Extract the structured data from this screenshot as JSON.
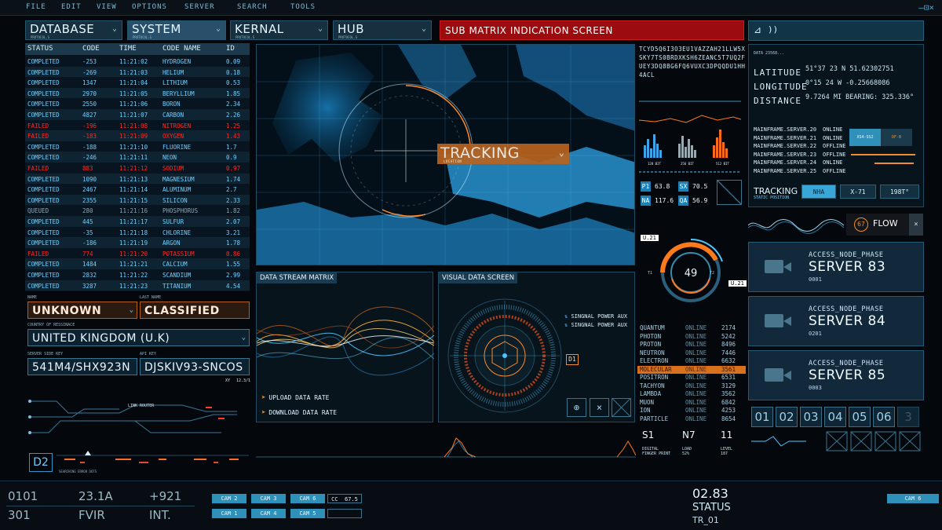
{
  "menu": [
    "FILE",
    "EDIT",
    "VIEW",
    "OPTIONS",
    "SERVER",
    "SEARCH",
    "TOOLS"
  ],
  "window_controls": "—⊡×",
  "dropdowns": [
    {
      "label": "DATABASE",
      "sub": "PROTOCOL.S"
    },
    {
      "label": "SYSTEM",
      "sub": "PROTOCOL.S"
    },
    {
      "label": "KERNAL",
      "sub": "PROTOCOL.S"
    },
    {
      "label": "HUB",
      "sub": "PROTOCOL.S"
    }
  ],
  "sub_matrix_title": "SUB MATRIX INDICATION SCREEN",
  "table": {
    "headers": [
      "STATUS",
      "CODE",
      "TIME",
      "CODE NAME",
      "ID"
    ],
    "rows": [
      [
        "COMPLETED",
        "-253",
        "11:21:02",
        "HYDROGEN",
        "0.09"
      ],
      [
        "COMPLETED",
        "-269",
        "11:21:03",
        "HELIUM",
        "0.18"
      ],
      [
        "COMPLETED",
        "1347",
        "11:21:04",
        "LITHIUM",
        "0.53"
      ],
      [
        "COMPLETED",
        "2970",
        "11:21:05",
        "BERYLLIUM",
        "1.85"
      ],
      [
        "COMPLETED",
        "2550",
        "11:21:06",
        "BORON",
        "2.34"
      ],
      [
        "COMPLETED",
        "4827",
        "11:21:07",
        "CARBON",
        "2.26"
      ],
      [
        "FAILED",
        "-196",
        "11:21:08",
        "NITROGEN",
        "1.25"
      ],
      [
        "FAILED",
        "-183",
        "11:21:09",
        "OXYGEN",
        "1.43"
      ],
      [
        "COMPLETED",
        "-188",
        "11:21:10",
        "FLUORINE",
        "1.7"
      ],
      [
        "COMPLETED",
        "-246",
        "11:21:11",
        "NEON",
        "0.9"
      ],
      [
        "FAILED",
        "883",
        "11:21:12",
        "SODIUM",
        "0.97"
      ],
      [
        "COMPLETED",
        "1090",
        "11:21:13",
        "MAGNESIUM",
        "1.74"
      ],
      [
        "COMPLETED",
        "2467",
        "11:21:14",
        "ALUMINUM",
        "2.7"
      ],
      [
        "COMPLETED",
        "2355",
        "11:21:15",
        "SILICON",
        "2.33"
      ],
      [
        "QUEUED",
        "280",
        "11:21:16",
        "PHOSPHORUS",
        "1.82"
      ],
      [
        "COMPLETED",
        "445",
        "11:21:17",
        "SULFUR",
        "2.07"
      ],
      [
        "COMPLETED",
        "-35",
        "11:21:18",
        "CHLORINE",
        "3.21"
      ],
      [
        "COMPLETED",
        "-186",
        "11:21:19",
        "ARGON",
        "1.78"
      ],
      [
        "FAILED",
        "774",
        "11:21:20",
        "POTASSIUM",
        "0.86"
      ],
      [
        "COMPLETED",
        "1484",
        "11:21:21",
        "CALCIUM",
        "1.55"
      ],
      [
        "COMPLETED",
        "2832",
        "11:21:22",
        "SCANDIUM",
        "2.99"
      ],
      [
        "COMPLETED",
        "3287",
        "11:21:23",
        "TITANIUM",
        "4.54"
      ]
    ]
  },
  "form": {
    "name_label": "NAME",
    "name": "UNKNOWN",
    "last_name_label": "LAST NAME",
    "last_name": "CLASSIFIED",
    "country_label": "COUNTRY OF RESSINACE",
    "country": "UNITED KINGDOM (U.K)",
    "server_key_label": "SERVER SIDE KEY",
    "server_key": "541M4/SHX923N",
    "api_key_label": "API KEY",
    "api_key": "DJSKIV93-SNCOS",
    "xy": "XY",
    "xy_val": "12.3/1"
  },
  "router": {
    "title": "LINK ROUTER",
    "badge": "D2",
    "footer": "SEARCHING ERROR DOTS"
  },
  "map": {
    "tracking": "TRACKING",
    "tracking_sub": "LOCATION"
  },
  "data_stream": {
    "title": "DATA STREAM MATRIX",
    "upload": "UPLOAD DATA RATE",
    "download": "DOWNLOAD DATA RATE"
  },
  "visual": {
    "title": "VISUAL DATA SCREEN",
    "power1": "SINGNAL POWER AUX",
    "power2": "SINGNAL POWER AUX",
    "tag": "D1"
  },
  "codes": "TCYD5Q6I3O3EU1VAZZAH21LLW5XSKY7TS0BRDXKSH6ZEANC5T7UQ2FUEY3DQ8BG6FQ6VUXC3DPQQDU1HH4ACL",
  "bits": [
    "128 BIT",
    "256 BIT",
    "512 BIT"
  ],
  "stats": [
    {
      "k": "P1",
      "v": "63.8"
    },
    {
      "k": "SX",
      "v": "70.5"
    },
    {
      "k": "NA",
      "v": "117.6"
    },
    {
      "k": "QA",
      "v": "56.9"
    }
  ],
  "gauge": {
    "value": "49",
    "tag1": "U.21",
    "tag2": "U.21",
    "t1": "T1",
    "t2": "T2"
  },
  "elements": [
    {
      "name": "QUANTUM",
      "status": "ONLINE",
      "code": "2174"
    },
    {
      "name": "PHOTON",
      "status": "ONLINE",
      "code": "5242"
    },
    {
      "name": "PROTON",
      "status": "ONLINE",
      "code": "8496"
    },
    {
      "name": "NEUTRON",
      "status": "ONLINE",
      "code": "7446"
    },
    {
      "name": "ELECTRON",
      "status": "ONLINE",
      "code": "6632"
    },
    {
      "name": "MOLECULAR",
      "status": "ONLINE",
      "code": "3561"
    },
    {
      "name": "POSITRON",
      "status": "ONLINE",
      "code": "6531"
    },
    {
      "name": "TACHYON",
      "status": "ONLINE",
      "code": "3129"
    },
    {
      "name": "LAMBDA",
      "status": "ONLINE",
      "code": "3562"
    },
    {
      "name": "MUON",
      "status": "ONLINE",
      "code": "6842"
    },
    {
      "name": "ION",
      "status": "ONLINE",
      "code": "4253"
    },
    {
      "name": "PARTICLE",
      "status": "ONLINE",
      "code": "8654"
    }
  ],
  "readouts": [
    {
      "v": "S1",
      "l1": "DIGITAL",
      "l2": "FINGER PRINT"
    },
    {
      "v": "N7",
      "l1": "LOAD",
      "l2": "52%"
    },
    {
      "v": "11",
      "l1": "LEVEL",
      "l2": "187"
    }
  ],
  "coords": {
    "data": "DATA 23568...",
    "lat_label": "LATITUDE",
    "lat": "51°37 23 N  51.62302751",
    "lon_label": "LONGITUDE",
    "lon": "0°15 24 W  -0.25668086",
    "dist_label": "DISTANCE",
    "dist": "9.7264 MI  BEARING: 325.336°"
  },
  "mainframes": [
    {
      "name": "MAINFRAME.SERVER.20",
      "status": "ONLINE"
    },
    {
      "name": "MAINFRAME.SERVER.21",
      "status": "ONLINE"
    },
    {
      "name": "MAINFRAME.SERVER.22",
      "status": "OFFLINE"
    },
    {
      "name": "MAINFRAME.SERVER.23",
      "status": "OFFLINE"
    },
    {
      "name": "MAINFRAME.SERVER.24",
      "status": "ONLINE"
    },
    {
      "name": "MAINFRAME.SERVER.25",
      "status": "OFFLINE"
    }
  ],
  "mf_buttons": [
    "XS4-SS2",
    "DF-B"
  ],
  "tracking_panel": {
    "title": "TRACKING",
    "sub": "STATIC POSITION",
    "buttons": [
      "NHA",
      "X-71",
      "198T°"
    ]
  },
  "flow": {
    "value": "67",
    "label": "FLOW",
    "close": "×"
  },
  "servers": [
    {
      "k": "ACCESS_NODE_PHASE",
      "n": "SERVER 83",
      "id": "0001"
    },
    {
      "k": "ACCESS_NODE_PHASE",
      "n": "SERVER 84",
      "id": "0201"
    },
    {
      "k": "ACCESS_NODE_PHASE",
      "n": "SERVER 85",
      "id": "0003"
    }
  ],
  "slots": [
    "01",
    "02",
    "03",
    "04",
    "05",
    "06",
    "3"
  ],
  "bottom": {
    "n1": "0101",
    "n2": "23.1A",
    "n3": "+921",
    "n4": "301",
    "n5": "FVIR",
    "n6": "INT.",
    "cams": [
      "CAM 2",
      "CAM 3",
      "CAM 6",
      "CAM 1",
      "CAM 4",
      "CAM 5"
    ],
    "cc": "CC",
    "cc_val": "67.5",
    "status_num": "02.83",
    "status": "STATUS",
    "tr": "TR_01",
    "cam_right": "CAM 6"
  },
  "colors": {
    "accent": "#38a7d8",
    "alert": "#ff2a26",
    "warn": "#d8701c",
    "bg": "#04080c"
  }
}
